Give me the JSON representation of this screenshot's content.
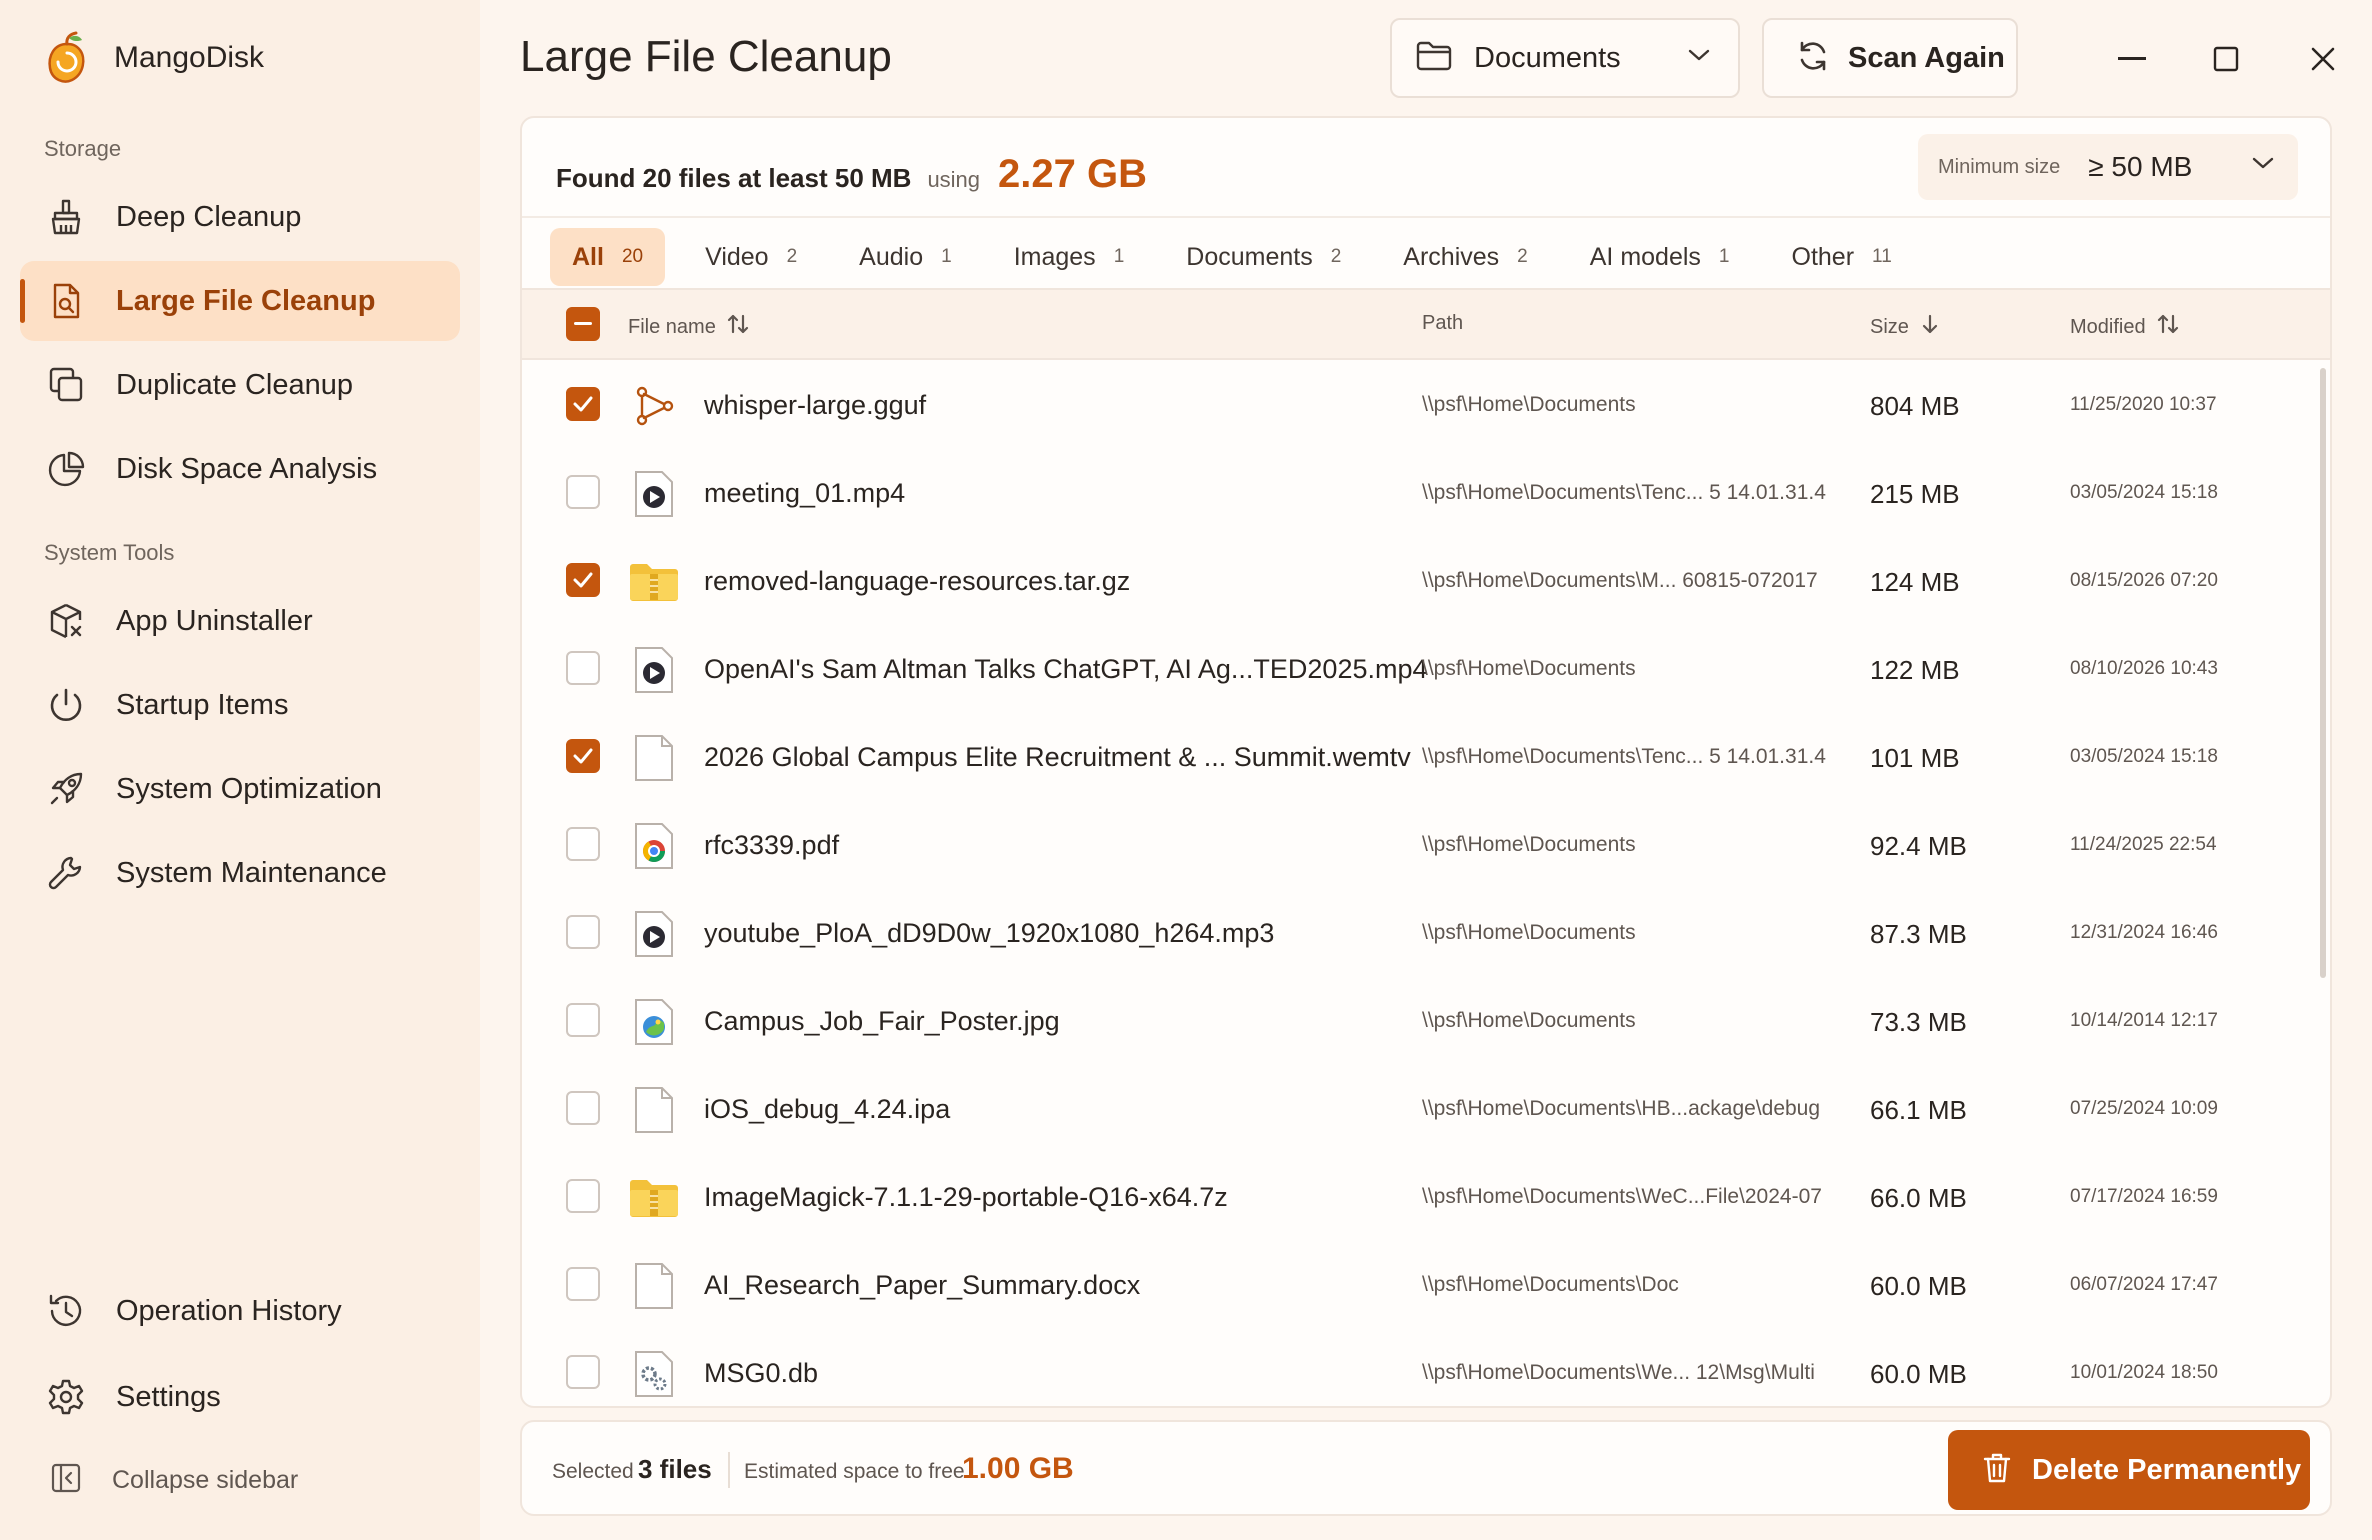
{
  "app": {
    "name": "MangoDisk"
  },
  "sidebar": {
    "storage_label": "Storage",
    "tools_label": "System Tools",
    "items": [
      {
        "label": "Deep Cleanup",
        "icon": "broom-icon"
      },
      {
        "label": "Large File Cleanup",
        "icon": "search-file-icon",
        "active": true
      },
      {
        "label": "Duplicate Cleanup",
        "icon": "duplicate-icon"
      },
      {
        "label": "Disk Space Analysis",
        "icon": "pie-chart-icon"
      },
      {
        "label": "App Uninstaller",
        "icon": "package-remove-icon"
      },
      {
        "label": "Startup Items",
        "icon": "power-icon"
      },
      {
        "label": "System Optimization",
        "icon": "rocket-icon"
      },
      {
        "label": "System Maintenance",
        "icon": "wrench-icon"
      },
      {
        "label": "Operation History",
        "icon": "history-icon"
      },
      {
        "label": "Settings",
        "icon": "gear-icon"
      }
    ],
    "collapse_label": "Collapse sidebar"
  },
  "header": {
    "title": "Large File Cleanup",
    "folder": "Documents",
    "scan_label": "Scan Again"
  },
  "summary": {
    "found": "Found 20 files at least 50 MB",
    "using": "using",
    "total": "2.27 GB",
    "min_size_label": "Minimum size",
    "min_size_value": "≥ 50 MB"
  },
  "tabs": [
    {
      "label": "All",
      "count": "20",
      "active": true
    },
    {
      "label": "Video",
      "count": "2"
    },
    {
      "label": "Audio",
      "count": "1"
    },
    {
      "label": "Images",
      "count": "1"
    },
    {
      "label": "Documents",
      "count": "2"
    },
    {
      "label": "Archives",
      "count": "2"
    },
    {
      "label": "AI models",
      "count": "1"
    },
    {
      "label": "Other",
      "count": "11"
    }
  ],
  "table": {
    "columns": {
      "name": "File name",
      "path": "Path",
      "size": "Size",
      "modified": "Modified"
    },
    "rows": [
      {
        "checked": true,
        "icon": "model-graph-icon",
        "name": "whisper-large.gguf",
        "path": "\\\\psf\\Home\\Documents",
        "size": "804 MB",
        "modified": "11/25/2020 10:37"
      },
      {
        "checked": false,
        "icon": "video-file-icon",
        "name": "meeting_01.mp4",
        "path": "\\\\psf\\Home\\Documents\\Tenc...  5 14.01.31.4",
        "size": "215 MB",
        "modified": "03/05/2024 15:18"
      },
      {
        "checked": true,
        "icon": "archive-folder-icon",
        "name": "removed-language-resources.tar.gz",
        "path": "\\\\psf\\Home\\Documents\\M...  60815-072017",
        "size": "124 MB",
        "modified": "08/15/2026 07:20"
      },
      {
        "checked": false,
        "icon": "video-file-icon",
        "name": "OpenAI's Sam Altman Talks ChatGPT, AI Ag...TED2025.mp4",
        "path": "\\\\psf\\Home\\Documents",
        "size": "122 MB",
        "modified": "08/10/2026 10:43"
      },
      {
        "checked": true,
        "icon": "blank-file-icon",
        "name": "2026 Global Campus Elite Recruitment & ...  Summit.wemtv",
        "path": "\\\\psf\\Home\\Documents\\Tenc...  5 14.01.31.4",
        "size": "101 MB",
        "modified": "03/05/2024 15:18"
      },
      {
        "checked": false,
        "icon": "pdf-chrome-icon",
        "name": "rfc3339.pdf",
        "path": "\\\\psf\\Home\\Documents",
        "size": "92.4 MB",
        "modified": "11/24/2025 22:54"
      },
      {
        "checked": false,
        "icon": "video-file-icon",
        "name": "youtube_PloA_dD9D0w_1920x1080_h264.mp3",
        "path": "\\\\psf\\Home\\Documents",
        "size": "87.3 MB",
        "modified": "12/31/2024 16:46"
      },
      {
        "checked": false,
        "icon": "image-file-icon",
        "name": "Campus_Job_Fair_Poster.jpg",
        "path": "\\\\psf\\Home\\Documents",
        "size": "73.3 MB",
        "modified": "10/14/2014 12:17"
      },
      {
        "checked": false,
        "icon": "blank-file-icon",
        "name": "iOS_debug_4.24.ipa",
        "path": "\\\\psf\\Home\\Documents\\HB...ackage\\debug",
        "size": "66.1 MB",
        "modified": "07/25/2024 10:09"
      },
      {
        "checked": false,
        "icon": "archive-folder-icon",
        "name": "ImageMagick-7.1.1-29-portable-Q16-x64.7z",
        "path": "\\\\psf\\Home\\Documents\\WeC...File\\2024-07",
        "size": "66.0 MB",
        "modified": "07/17/2024 16:59"
      },
      {
        "checked": false,
        "icon": "blank-file-icon",
        "name": "AI_Research_Paper_Summary.docx",
        "path": "\\\\psf\\Home\\Documents\\Doc",
        "size": "60.0 MB",
        "modified": "06/07/2024 17:47"
      },
      {
        "checked": false,
        "icon": "settings-file-icon",
        "name": "MSG0.db",
        "path": "\\\\psf\\Home\\Documents\\We...  12\\Msg\\Multi",
        "size": "60.0 MB",
        "modified": "10/01/2024 18:50"
      }
    ]
  },
  "footer": {
    "selected_label": "Selected",
    "selected_count": "3 files",
    "estimate_label": "Estimated space to free",
    "estimate_value": "1.00 GB",
    "delete_label": "Delete Permanently"
  },
  "colors": {
    "accent": "#c4560e",
    "accent_soft": "#fde0c6",
    "sidebar_bg": "#fbefe4"
  }
}
